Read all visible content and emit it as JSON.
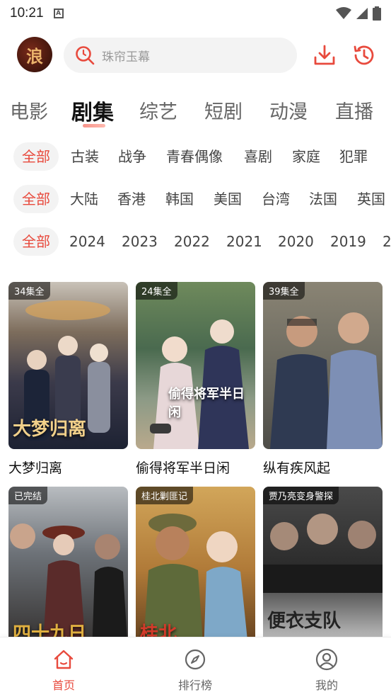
{
  "status": {
    "time": "10:21",
    "a_icon": "A"
  },
  "header": {
    "logo_text": "浪",
    "search_placeholder": "珠帘玉幕"
  },
  "tabs": [
    {
      "label": "电影"
    },
    {
      "label": "剧集",
      "active": true
    },
    {
      "label": "综艺"
    },
    {
      "label": "短剧"
    },
    {
      "label": "动漫"
    },
    {
      "label": "直播"
    }
  ],
  "filters": {
    "genre": [
      "全部",
      "古装",
      "战争",
      "青春偶像",
      "喜剧",
      "家庭",
      "犯罪"
    ],
    "region": [
      "全部",
      "大陆",
      "香港",
      "韩国",
      "美国",
      "台湾",
      "法国",
      "英国"
    ],
    "year": [
      "全部",
      "2024",
      "2023",
      "2022",
      "2021",
      "2020",
      "2019",
      "2"
    ]
  },
  "cards": [
    {
      "badge": "34集全",
      "title": "大梦归离",
      "poster_text": "大梦归离"
    },
    {
      "badge": "24集全",
      "title": "偷得将军半日闲",
      "poster_text": "偷得将军半日闲"
    },
    {
      "badge": "39集全",
      "title": "纵有疾风起",
      "poster_text": ""
    },
    {
      "badge": "已完结",
      "title": "",
      "poster_text": "四十九日"
    },
    {
      "badge": "桂北剿匪记",
      "title": "",
      "poster_text": "桂北"
    },
    {
      "badge": "贾乃亮变身警探",
      "title": "",
      "poster_text": "便衣支队"
    }
  ],
  "bottom_nav": [
    {
      "label": "首页",
      "icon": "home-icon",
      "active": true
    },
    {
      "label": "排行榜",
      "icon": "compass-icon"
    },
    {
      "label": "我的",
      "icon": "user-icon"
    }
  ],
  "colors": {
    "accent": "#e84a3d",
    "chip_bg": "#f3f3f3"
  }
}
